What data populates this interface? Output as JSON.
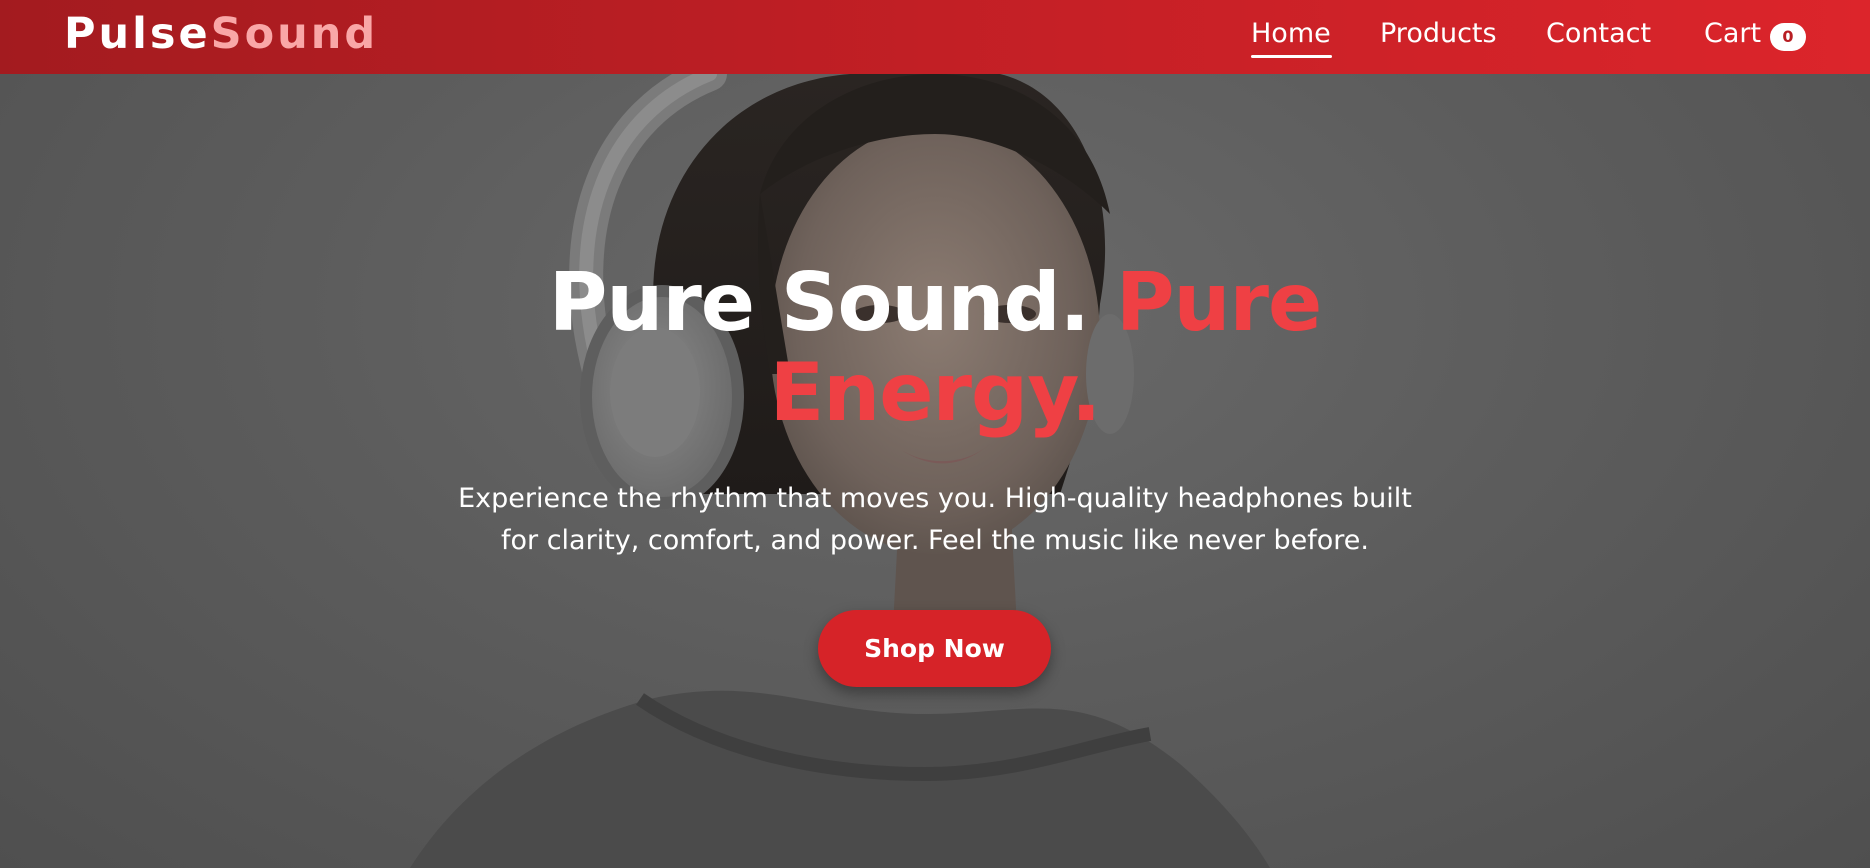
{
  "brand": {
    "part1": "Pulse",
    "part2": "Sound"
  },
  "nav": {
    "items": [
      {
        "label": "Home",
        "active": true
      },
      {
        "label": "Products"
      },
      {
        "label": "Contact"
      },
      {
        "label": "Cart"
      }
    ],
    "cart_count": "0"
  },
  "hero": {
    "title_white": "Pure Sound.",
    "title_red_1": "Pure",
    "title_red_2": "Energy.",
    "subtitle_line1": "Experience the rhythm that moves you. High-quality headphones built",
    "subtitle_line2": "for clarity, comfort, and power. Feel the music like never before.",
    "cta_label": "Shop Now"
  },
  "colors": {
    "nav_start": "#a31b1f",
    "nav_end": "#dc252b",
    "brand_accent": "#f9a7a7",
    "title_accent": "#ef4044",
    "button": "#d62328",
    "overlay": "#5a5a5a"
  }
}
